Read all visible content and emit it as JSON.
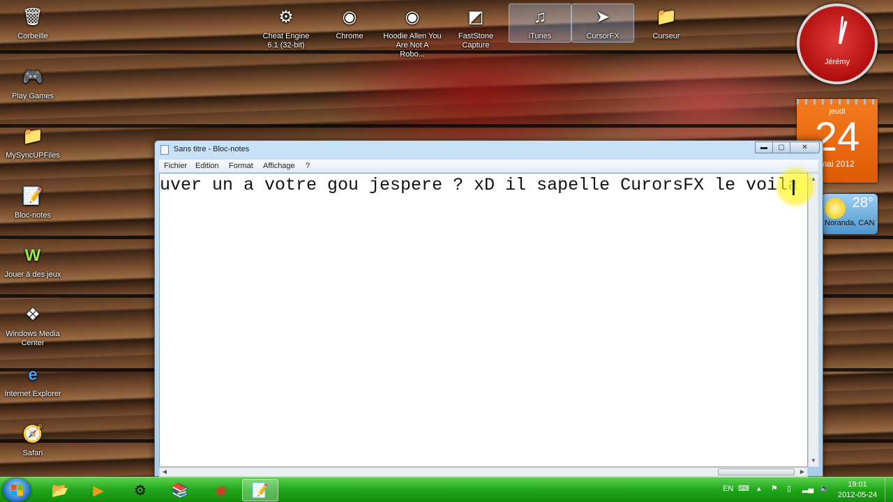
{
  "desktop": {
    "left_icons": [
      {
        "label": "Corbeille",
        "icon": "recycle-bin-icon"
      },
      {
        "label": "Play Games",
        "icon": "games-icon"
      },
      {
        "label": "MySyncUPFiles",
        "icon": "folder-icon"
      },
      {
        "label": "Bloc-notes",
        "icon": "notepad-icon"
      },
      {
        "label": "Jouer à des jeux",
        "icon": "wild-games-icon"
      },
      {
        "label": "Windows Media Center",
        "icon": "media-center-icon"
      },
      {
        "label": "Internet Explorer",
        "icon": "internet-explorer-icon"
      },
      {
        "label": "Safari",
        "icon": "safari-icon"
      }
    ],
    "top_icons": [
      {
        "label": "Cheat Engine 6.1 (32-bit)",
        "icon": "cheat-engine-icon"
      },
      {
        "label": "Chrome",
        "icon": "chrome-icon"
      },
      {
        "label": "Hoodie Allen You Are Not A Robo...",
        "icon": "chrome-icon"
      },
      {
        "label": "FastStone Capture",
        "icon": "faststone-icon"
      },
      {
        "label": "iTunes",
        "icon": "itunes-icon"
      },
      {
        "label": "CursorFX",
        "icon": "cursorfx-icon"
      },
      {
        "label": "Curseur",
        "icon": "folder-icon"
      }
    ]
  },
  "gadgets": {
    "clock_name": "Jérémy",
    "calendar": {
      "day_name": "jeudi",
      "day_number": "24",
      "month_year": "mai 2012"
    },
    "weather": {
      "temperature": "28°",
      "location": "Noranda, CAN"
    }
  },
  "notepad": {
    "title": "Sans titre - Bloc-notes",
    "menu": [
      "Fichier",
      "Edition",
      "Format",
      "Affichage",
      "?"
    ],
    "content": "uver un a votre gou jespere ? xD il sapelle CurorsFX le voila",
    "window_buttons": {
      "minimize": "▬",
      "maximize": "▢",
      "close": "✕"
    }
  },
  "taskbar": {
    "apps": [
      "explorer-icon",
      "media-player-icon",
      "cheat-engine-icon",
      "winrar-icon",
      "chrome-icon",
      "notepad-icon"
    ],
    "active_app": "notepad-icon",
    "language": "EN",
    "time": "19:01",
    "date": "2012-05-24"
  }
}
